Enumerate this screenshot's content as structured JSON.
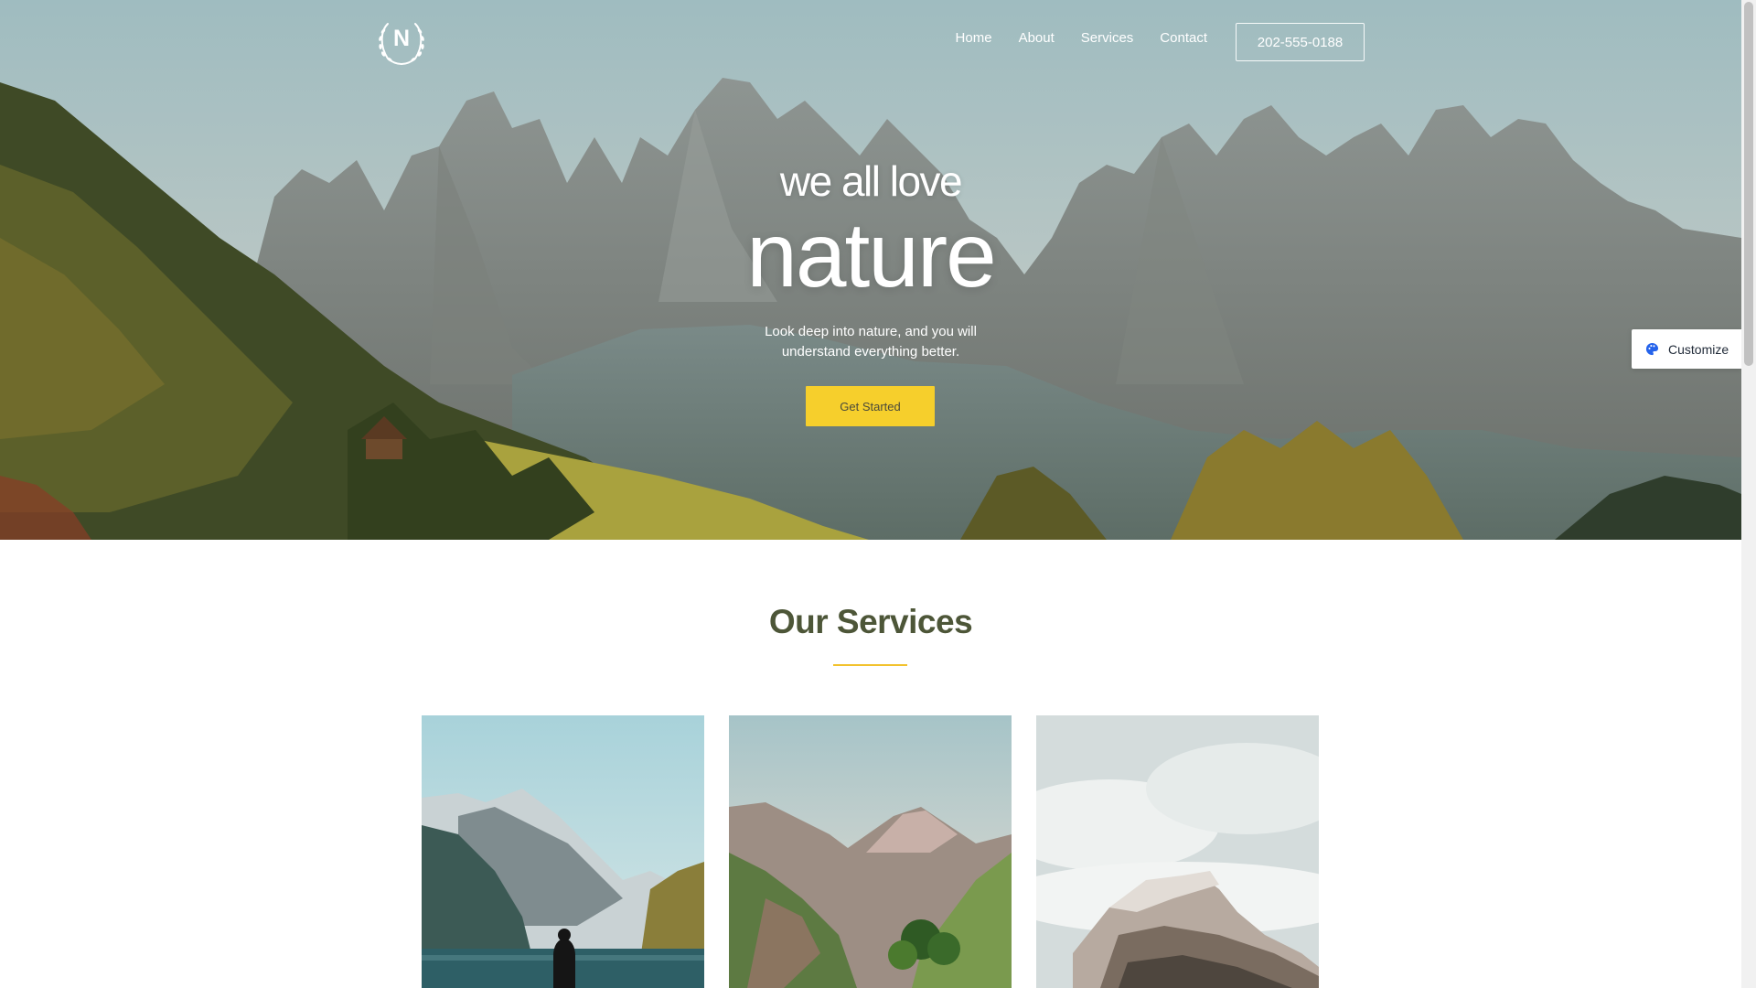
{
  "header": {
    "logo_letter": "N",
    "nav": [
      "Home",
      "About",
      "Services",
      "Contact"
    ],
    "phone": "202-555-0188"
  },
  "hero": {
    "kicker": "we all love",
    "headline": "nature",
    "subtitle": "Look deep into nature, and you will understand everything better.",
    "cta": "Get Started"
  },
  "services": {
    "title": "Our Services"
  },
  "customize": {
    "label": "Customize",
    "icon": "palette-icon"
  },
  "colors": {
    "accent": "#f6cf2c",
    "title": "#4d5638"
  }
}
